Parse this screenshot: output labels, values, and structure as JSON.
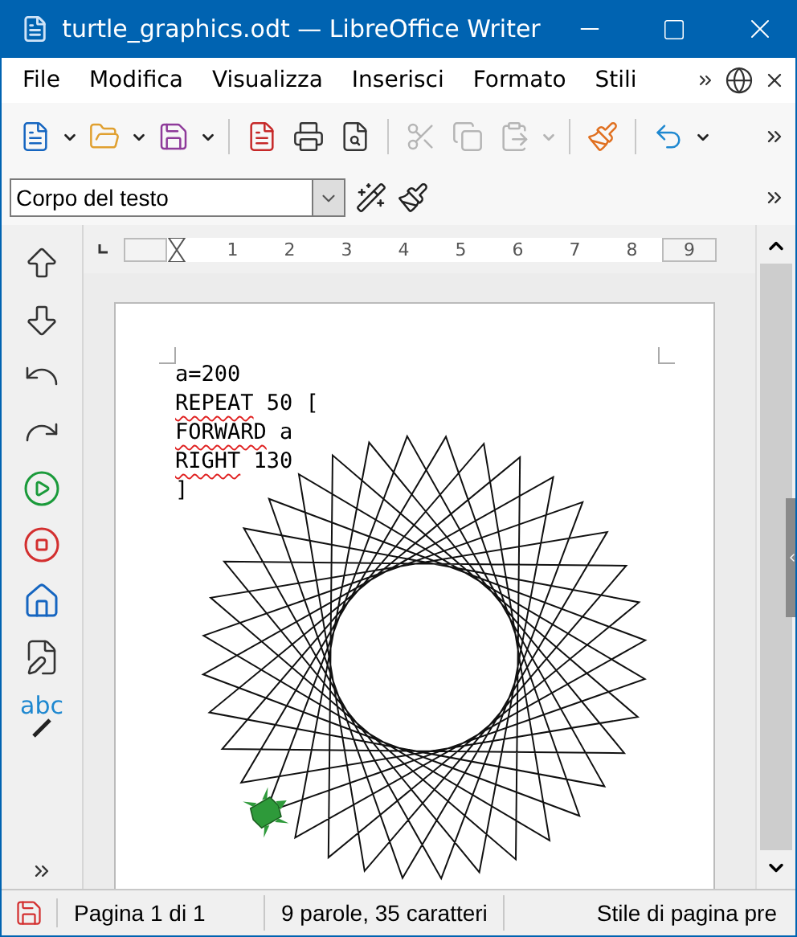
{
  "window": {
    "title": "turtle_graphics.odt — LibreOffice Writer"
  },
  "menu": [
    "File",
    "Modifica",
    "Visualizza",
    "Inserisci",
    "Formato",
    "Stili"
  ],
  "standard_toolbar": [
    {
      "kind": "new",
      "disabled": false,
      "dropdown": true
    },
    {
      "kind": "open",
      "disabled": false,
      "dropdown": true
    },
    {
      "kind": "save",
      "disabled": false,
      "dropdown": true
    },
    {
      "kind": "separator"
    },
    {
      "kind": "pdf",
      "disabled": false,
      "dropdown": false
    },
    {
      "kind": "print",
      "disabled": false,
      "dropdown": false
    },
    {
      "kind": "preview",
      "disabled": false,
      "dropdown": false
    },
    {
      "kind": "separator"
    },
    {
      "kind": "cut",
      "disabled": true,
      "dropdown": false
    },
    {
      "kind": "copy",
      "disabled": true,
      "dropdown": false
    },
    {
      "kind": "paste",
      "disabled": true,
      "dropdown": true
    },
    {
      "kind": "separator"
    },
    {
      "kind": "clone",
      "disabled": false,
      "dropdown": false
    },
    {
      "kind": "separator"
    },
    {
      "kind": "undo",
      "disabled": false,
      "dropdown": true
    }
  ],
  "paragraph_style": {
    "value": "Corpo del testo"
  },
  "ruler": {
    "numbers": [
      "1",
      "2",
      "3",
      "4",
      "5",
      "6",
      "7",
      "8"
    ],
    "last_number": "9"
  },
  "turtle_toolbar": {
    "spellcheck_label": "abc"
  },
  "document": {
    "lines": [
      {
        "text": "a=200",
        "misspelled": false
      },
      {
        "text": "REPEAT",
        "misspelled": true,
        "rest": " 50 ["
      },
      {
        "text": "FORWARD",
        "misspelled": true,
        "rest": " a"
      },
      {
        "text": "RIGHT",
        "misspelled": true,
        "rest": " 130"
      },
      {
        "text": "]",
        "misspelled": false
      }
    ]
  },
  "status_bar": {
    "modified": true,
    "page": "Pagina 1 di 1",
    "counts": "9 parole, 35 caratteri",
    "page_style": "Stile di pagina pre"
  }
}
